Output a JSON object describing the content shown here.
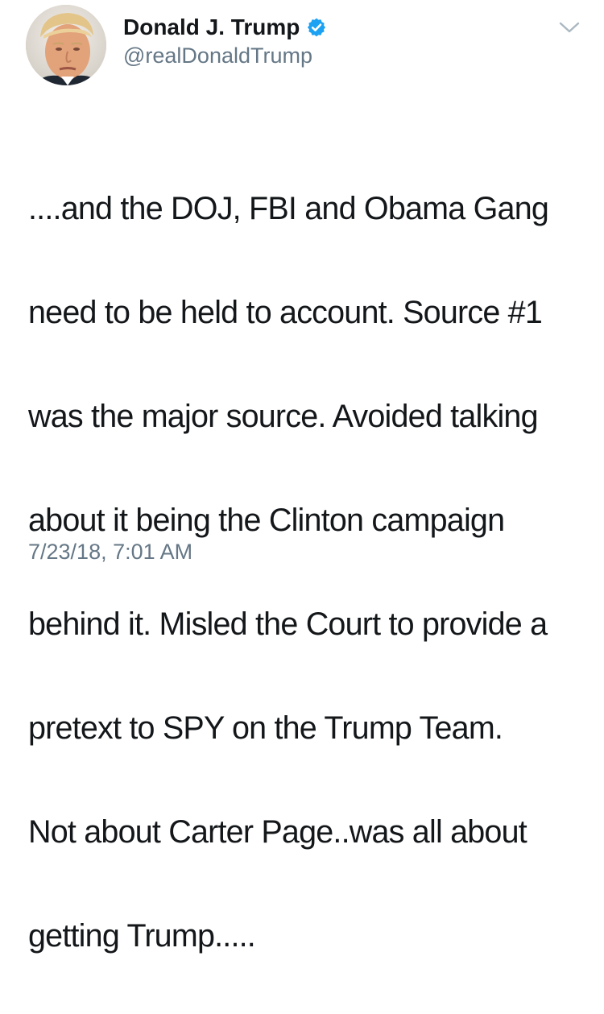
{
  "tweet": {
    "display_name": "Donald J. Trump",
    "handle": "@realDonaldTrump",
    "verified": true,
    "text_lines": [
      "....and the DOJ, FBI and Obama Gang",
      "need to be held to account. Source #1",
      "was the major source. Avoided talking",
      "about it being the Clinton campaign",
      "behind it. Misled the Court to provide a",
      "pretext to SPY on the Trump Team.",
      "Not about Carter Page..was all about",
      "getting Trump....."
    ],
    "timestamp": "7/23/18, 7:01 AM"
  },
  "icons": {
    "verified": "verified-badge-icon",
    "menu": "chevron-down-icon",
    "avatar": "profile-photo"
  },
  "colors": {
    "text": "#14171a",
    "secondary": "#657786",
    "verified": "#1da1f2",
    "chevron": "#aab8c2"
  }
}
